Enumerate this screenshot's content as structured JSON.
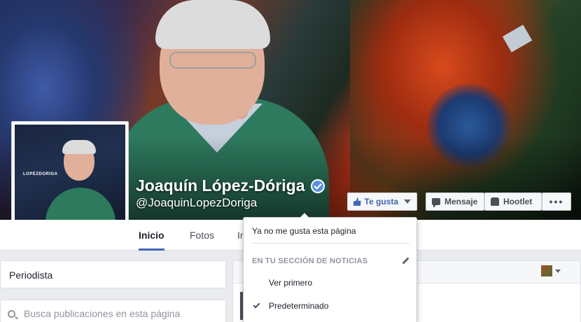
{
  "profile": {
    "name": "Joaquín López-Dóriga",
    "handle": "@JoaquinLopezDoriga",
    "avatar_logo_text": "LOPEZDORIGA"
  },
  "actions": {
    "like_label": "Te gusta",
    "message_label": "Mensaje",
    "hootlet_label": "Hootlet",
    "more_label": "•••"
  },
  "tabs": [
    {
      "label": "Inicio",
      "active": true
    },
    {
      "label": "Fotos",
      "active": false
    },
    {
      "label": "In",
      "active": false
    }
  ],
  "sidebar": {
    "category": "Periodista",
    "search_placeholder": "Busca publicaciones en esta página"
  },
  "like_menu": {
    "unlike": "Ya no me gusta esta página",
    "section_title": "EN TU SECCIÓN DE NOTICIAS",
    "options": [
      {
        "label": "Ver primero",
        "checked": false
      },
      {
        "label": "Predeterminado",
        "checked": true
      }
    ]
  },
  "colors": {
    "accent": "#4267b2",
    "verified_badge": "#5b8fe0",
    "page_background": "#e9ebee"
  },
  "icons": [
    "thumbs-up-icon",
    "chevron-down-icon",
    "message-icon",
    "hootlet-icon",
    "more-icon",
    "verified-icon",
    "search-icon",
    "pencil-icon",
    "check-icon"
  ]
}
